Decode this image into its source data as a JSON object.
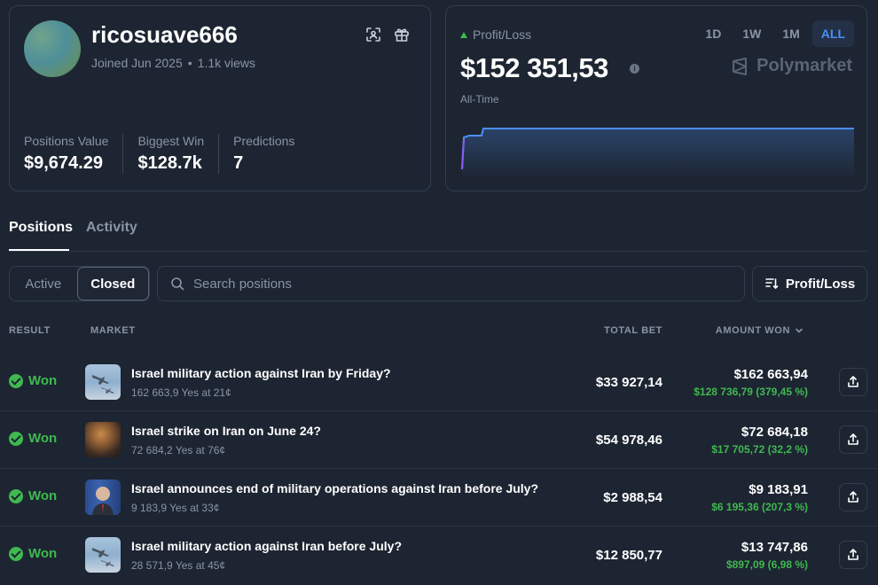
{
  "profile": {
    "username": "ricosuave666",
    "joined": "Joined Jun 2025",
    "dot": "•",
    "views": "1.1k views",
    "stats": [
      {
        "label": "Positions Value",
        "value": "$9,674.29"
      },
      {
        "label": "Biggest Win",
        "value": "$128.7k"
      },
      {
        "label": "Predictions",
        "value": "7"
      }
    ]
  },
  "pnl": {
    "label": "Profit/Loss",
    "value": "$152 351,53",
    "period_label": "All-Time",
    "ranges": [
      "1D",
      "1W",
      "1M",
      "ALL"
    ],
    "active_range": "ALL",
    "brand": "Polymarket",
    "line_color": "#4c8ff5"
  },
  "tabs": {
    "positions": "Positions",
    "activity": "Activity"
  },
  "filters": {
    "active": "Active",
    "closed": "Closed",
    "search_placeholder": "Search positions",
    "sort_label": "Profit/Loss"
  },
  "table": {
    "headers": {
      "result": "RESULT",
      "market": "MARKET",
      "total_bet": "TOTAL BET",
      "amount_won": "AMOUNT WON"
    },
    "rows": [
      {
        "result": "Won",
        "title": "Israel military action against Iran by Friday?",
        "sub": "162 663,9 Yes at 21¢",
        "bet": "$33 927,14",
        "won": "$162 663,94",
        "profit": "$128 736,79 (379,45 %)",
        "thumb": "jets"
      },
      {
        "result": "Won",
        "title": "Israel strike on Iran on June 24?",
        "sub": "72 684,2 Yes at 76¢",
        "bet": "$54 978,46",
        "won": "$72 684,18",
        "profit": "$17 705,72 (32,2 %)",
        "thumb": "smoke"
      },
      {
        "result": "Won",
        "title": "Israel announces end of military operations against Iran before July?",
        "sub": "9 183,9 Yes at 33¢",
        "bet": "$2 988,54",
        "won": "$9 183,91",
        "profit": "$6 195,36 (207,3 %)",
        "thumb": "person"
      },
      {
        "result": "Won",
        "title": "Israel military action against Iran before July?",
        "sub": "28 571,9 Yes at 45¢",
        "bet": "$12 850,77",
        "won": "$13 747,86",
        "profit": "$897,09 (6,98 %)",
        "thumb": "jets"
      }
    ]
  },
  "colors": {
    "accent": "#4c8ff5",
    "positive": "#3fb950",
    "background": "#1d2532"
  }
}
